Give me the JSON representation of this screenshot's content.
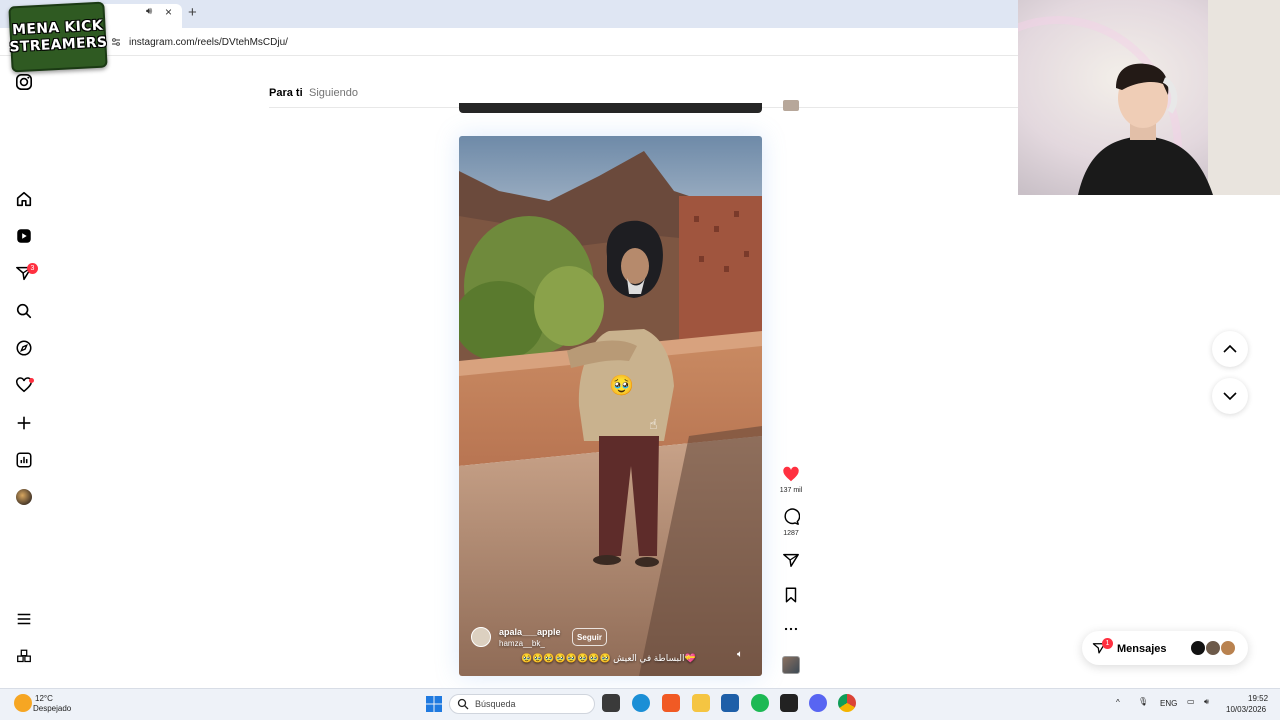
{
  "browser": {
    "url": "instagram.com/reels/DVtehMsCDju/",
    "new_tab_symbol": "+",
    "tab_close_symbol": "×"
  },
  "overlay_logo": {
    "line1": "MENA KICK",
    "line2": "STREAMERS"
  },
  "sidebar": {
    "notifications_badge": "3",
    "icons": [
      "instagram-logo-icon",
      "home-icon",
      "reels-icon",
      "direct-icon",
      "search-icon",
      "explore-icon",
      "heart-icon",
      "create-icon",
      "dashboard-icon",
      "profile-avatar",
      "menu-icon",
      "more-apps-icon"
    ]
  },
  "feed_tabs": {
    "for_you": "Para ti",
    "following": "Siguiendo"
  },
  "reel": {
    "author": "apala___apple",
    "coauthor": "hamza__bk_",
    "follow_label": "Seguir",
    "caption": "🥹🥹🥹🥹🥹🥹🥹🥹 البساطة في العيش💝",
    "emoji_sticker": "🥹"
  },
  "actions": {
    "likes": "137 mil",
    "comments": "1287",
    "colors": {
      "like": "#ff3040"
    }
  },
  "messages": {
    "label": "Mensajes",
    "badge": "1"
  },
  "taskbar": {
    "weather_temp": "12°C",
    "weather_desc": "Despejado",
    "search_placeholder": "Búsqueda",
    "language": "ENG",
    "time": "19:52",
    "date": "10/03/2026"
  }
}
